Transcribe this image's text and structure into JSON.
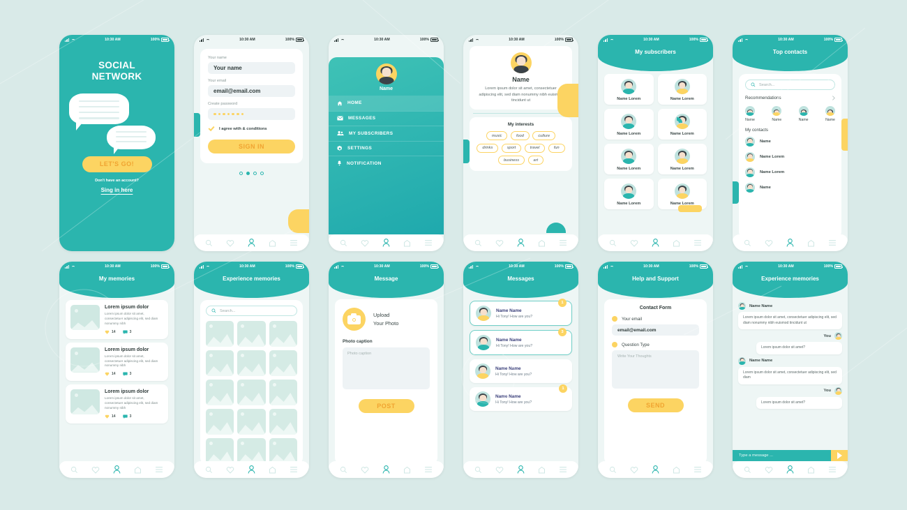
{
  "statusbar": {
    "time": "10:30 AM",
    "battery": "100%"
  },
  "nav": {
    "icons": [
      "search-icon",
      "heart-icon",
      "person-icon",
      "home-icon",
      "menu-icon"
    ],
    "active": 2
  },
  "colors": {
    "teal": "#2bb5ae",
    "yellow": "#fcd462",
    "yellow_text": "#f0a431",
    "background": "#d9eae8"
  },
  "screens": {
    "welcome": {
      "title_line1": "SOCIAL",
      "title_line2": "NETWORK",
      "cta": "LET'S GO!",
      "subtitle": "Don't have an account?",
      "link": "Sing in here"
    },
    "signup": {
      "name_label": "Your name",
      "name_value": "Your name",
      "email_label": "Your email",
      "email_value": "email@email.com",
      "password_label": "Create password",
      "password_dots": 7,
      "agree": "I agree with & conditions",
      "submit": "SIGN IN",
      "page_dots": 4,
      "active_dot": 1
    },
    "menu": {
      "profile_name": "Name",
      "items": [
        {
          "label": "HOME",
          "icon": "home-icon",
          "active": true
        },
        {
          "label": "MESSAGES",
          "icon": "mail-icon",
          "active": false
        },
        {
          "label": "MY SUBSCRIBERS",
          "icon": "people-icon",
          "active": false
        },
        {
          "label": "SETTINGS",
          "icon": "gear-icon",
          "active": false
        },
        {
          "label": "NOTIFICATION",
          "icon": "bell-icon",
          "active": false
        }
      ]
    },
    "profile": {
      "name": "Name",
      "description": "Lorem ipsum dolor sit amet, consectetuer adipiscing elit, sed diam nonummy nibh euismod tincidunt ut",
      "interests_title": "My interests",
      "interests": [
        "music",
        "food",
        "culture",
        "drinks",
        "sport",
        "travel",
        "fun",
        "business",
        "art"
      ]
    },
    "subscribers": {
      "title": "My subscribers",
      "cards": [
        {
          "name": "Name Lorem",
          "variant": "teal"
        },
        {
          "name": "Name Lorem",
          "variant": "yellow"
        },
        {
          "name": "Name Lorem",
          "variant": "teal"
        },
        {
          "name": "Name Lorem",
          "variant": "yellow"
        },
        {
          "name": "Name Lorem",
          "variant": "teal"
        },
        {
          "name": "Name Lorem",
          "variant": "yellow"
        },
        {
          "name": "Name Lorem",
          "variant": "teal"
        },
        {
          "name": "Name Lorem",
          "variant": "yellow"
        }
      ]
    },
    "contacts": {
      "title": "Top contacts",
      "search_placeholder": "Search...",
      "recommendations_title": "Recommendations",
      "recommendations": [
        {
          "name": "Name",
          "variant": "teal"
        },
        {
          "name": "Name",
          "variant": "yellow"
        },
        {
          "name": "Name",
          "variant": "teal"
        },
        {
          "name": "Name",
          "variant": "yellow"
        }
      ],
      "contacts_title": "My contacts",
      "contacts": [
        {
          "name": "Name",
          "variant": "teal"
        },
        {
          "name": "Name Lorem",
          "variant": "yellow"
        },
        {
          "name": "Name Lorem",
          "variant": "teal"
        },
        {
          "name": "Name",
          "variant": "teal"
        }
      ]
    },
    "memories": {
      "title": "My memories",
      "cards": [
        {
          "title": "Lorem ipsum dolor",
          "text": "Lorem ipsum dolor sit amet, consectetuer adipiscing elit, sed diam nonummy nibh",
          "likes": "14",
          "comments": "3"
        },
        {
          "title": "Lorem ipsum dolor",
          "text": "Lorem ipsum dolor sit amet, consectetuer adipiscing elit, sed diam nonummy nibh",
          "likes": "14",
          "comments": "3"
        },
        {
          "title": "Lorem ipsum dolor",
          "text": "Lorem ipsum dolor sit amet, consectetuer adipiscing elit, sed diam nonummy nibh",
          "likes": "14",
          "comments": "3"
        }
      ]
    },
    "gallery": {
      "title": "Experience memories",
      "search_placeholder": "Search...",
      "cells": 15
    },
    "upload": {
      "title": "Message",
      "upload_line1": "Upload",
      "upload_line2": "Your Photo",
      "caption_label": "Photo caption",
      "caption_placeholder": "Photo caption",
      "submit": "POST"
    },
    "messages": {
      "title": "Messages",
      "rows": [
        {
          "name": "Name Name",
          "preview": "Hi Tony! How are you?",
          "badge": "1",
          "unread": true,
          "variant": "yellow"
        },
        {
          "name": "Name Name",
          "preview": "Hi Tony! How are you?",
          "badge": "3",
          "unread": true,
          "variant": "teal"
        },
        {
          "name": "Name Name",
          "preview": "Hi Tony! How are you?",
          "badge": "",
          "unread": false,
          "variant": "yellow"
        },
        {
          "name": "Name Name",
          "preview": "Hi Tony! How are you?",
          "badge": "1",
          "unread": false,
          "variant": "teal"
        }
      ]
    },
    "support": {
      "title": "Help and Support",
      "form_title": "Contact Form",
      "email_label": "Your email",
      "email_value": "email@email.com",
      "question_label": "Question Type",
      "thoughts_placeholder": "Write Your Thoughts",
      "submit": "SEND"
    },
    "chat": {
      "title": "Experience memories",
      "messages": [
        {
          "who": "Name Name",
          "side": "left",
          "text": "Lorem ipsum dolor sit amet, consectetuer adipiscing elit, sed diam nonummy nibh euismod tincidunt ut"
        },
        {
          "who": "You",
          "side": "right",
          "text": "Lorem ipsum dolor sit amet?"
        },
        {
          "who": "Name Name",
          "side": "left",
          "text": "Lorem ipsum dolor sit amet, consectetuer adipiscing elit, sed diam"
        },
        {
          "who": "You",
          "side": "right",
          "text": "Lorem ipsum dolor sit amet?"
        }
      ],
      "input_placeholder": "Type a message ...",
      "send_icon": "send-icon"
    }
  }
}
